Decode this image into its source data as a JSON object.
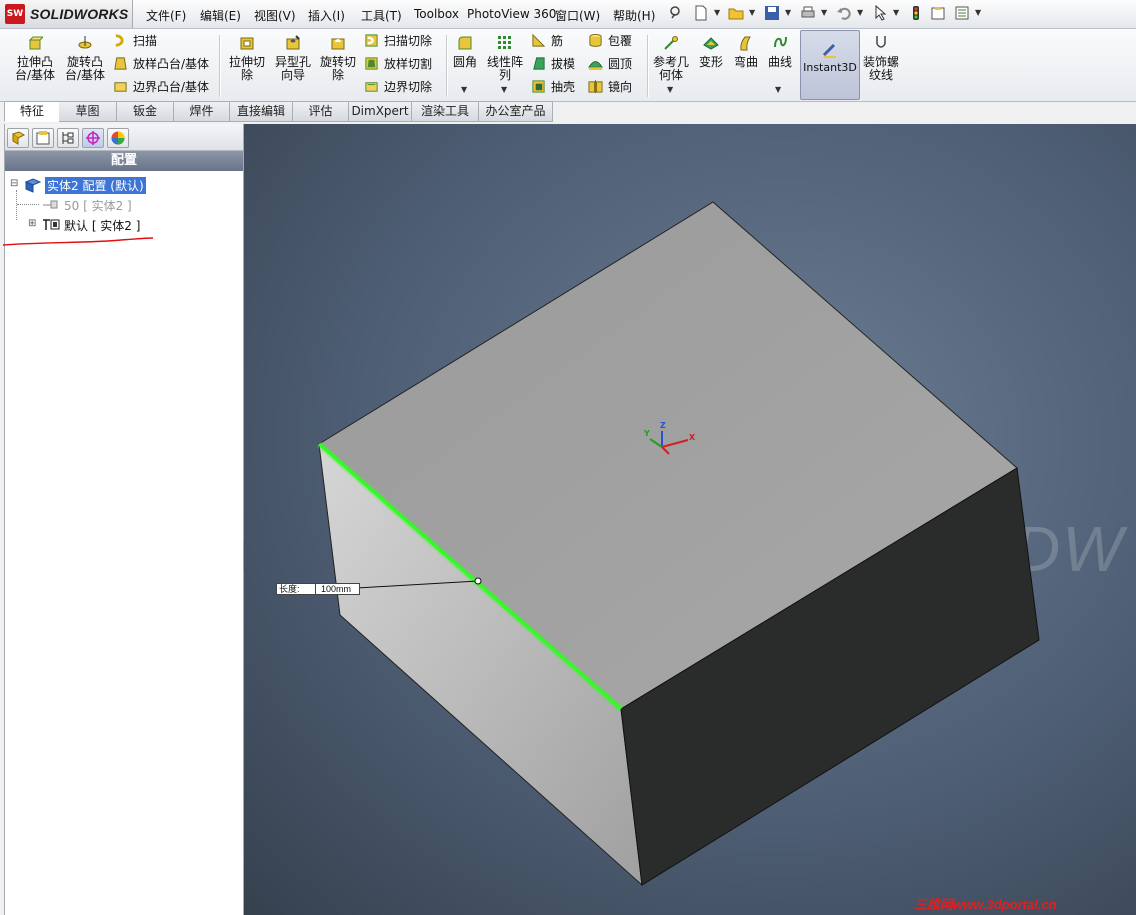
{
  "app": {
    "brand": "SOLIDWORKS",
    "brand_mark": "SW"
  },
  "menus": [
    "文件(F)",
    "编辑(E)",
    "视图(V)",
    "插入(I)",
    "工具(T)",
    "Toolbox",
    "PhotoView 360",
    "窗口(W)",
    "帮助(H)"
  ],
  "commands": {
    "extrude_boss": "拉伸凸\n台/基体",
    "revolve_boss": "旋转凸\n台/基体",
    "sweep": "扫描",
    "loft": "放样凸台/基体",
    "boundary_boss": "边界凸台/基体",
    "extrude_cut": "拉伸切\n除",
    "hole_wizard": "异型孔\n向导",
    "revolve_cut": "旋转切\n除",
    "swept_cut": "扫描切除",
    "lofted_cut": "放样切割",
    "boundary_cut": "边界切除",
    "fillet": "圆角",
    "linear_pattern": "线性阵\n列",
    "rib": "筋",
    "draft": "拔模",
    "shell": "抽壳",
    "wrap": "包覆",
    "dome": "圆顶",
    "mirror": "镜向",
    "ref_geometry": "参考几\n何体",
    "flex": "变形",
    "deform": "弯曲",
    "curves": "曲线",
    "instant3d": "Instant3D",
    "cosmetic_thread": "装饰螺\n纹线"
  },
  "tabs": [
    "特征",
    "草图",
    "钣金",
    "焊件",
    "直接编辑",
    "评估",
    "DimXpert",
    "渲染工具",
    "办公室产品"
  ],
  "active_tab": "特征",
  "panel": {
    "header": "配置",
    "tree": [
      {
        "label": "实体2 配置 (默认)",
        "selected": true
      },
      {
        "label": "50 [ 实体2 ]",
        "dim": true
      },
      {
        "label": "默认 [ 实体2 ]",
        "dim": false
      }
    ]
  },
  "viewport": {
    "dimension_label": "长度:",
    "dimension_value": "100mm",
    "triad": {
      "x": "X",
      "y": "Y",
      "z": "Z"
    },
    "watermark": "三维网www.3dportal.cn",
    "bg_logo_text": "DW"
  },
  "colors": {
    "selected_edge": "#2dff1f",
    "brand_red": "#c8191e",
    "selection": "#3d74d6"
  }
}
